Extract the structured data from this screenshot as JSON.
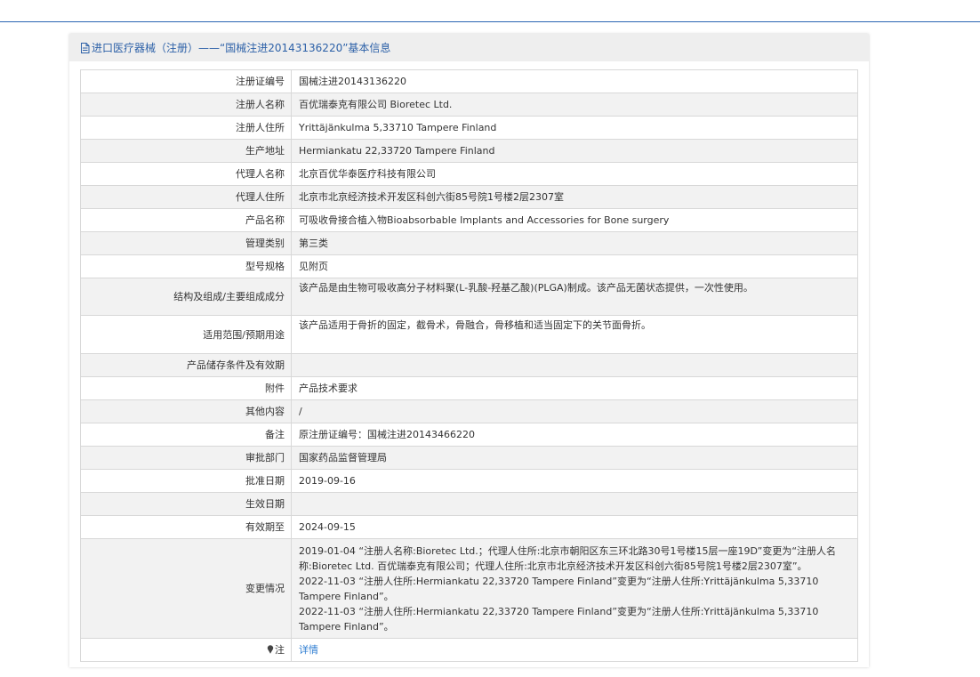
{
  "header": {
    "title_prefix": "进口医疗器械（注册）——",
    "title_quote": "“国械注进20143136220”基本信息"
  },
  "rows": [
    {
      "label": "注册证编号",
      "value": "国械注进20143136220"
    },
    {
      "label": "注册人名称",
      "value": "百优瑞泰克有限公司 Bioretec Ltd."
    },
    {
      "label": "注册人住所",
      "value": "Yrittäjänkulma 5,33710 Tampere Finland"
    },
    {
      "label": "生产地址",
      "value": "Hermiankatu 22,33720 Tampere Finland"
    },
    {
      "label": "代理人名称",
      "value": "北京百优华泰医疗科技有限公司"
    },
    {
      "label": "代理人住所",
      "value": "北京市北京经济技术开发区科创六街85号院1号楼2层2307室"
    },
    {
      "label": "产品名称",
      "value": "可吸收骨接合植入物Bioabsorbable Implants and Accessories for Bone surgery"
    },
    {
      "label": "管理类别",
      "value": "第三类"
    },
    {
      "label": "型号规格",
      "value": "见附页"
    },
    {
      "label": "结构及组成/主要组成成分",
      "value": "该产品是由生物可吸收高分子材料聚(L-乳酸-羟基乙酸)(PLGA)制成。该产品无菌状态提供，一次性使用。"
    },
    {
      "label": "适用范围/预期用途",
      "value": "该产品适用于骨折的固定，截骨术，骨融合，骨移植和适当固定下的关节面骨折。"
    },
    {
      "label": "产品储存条件及有效期",
      "value": ""
    },
    {
      "label": "附件",
      "value": "产品技术要求"
    },
    {
      "label": "其他内容",
      "value": "/"
    },
    {
      "label": "备注",
      "value": "原注册证编号：国械注进20143466220"
    },
    {
      "label": "审批部门",
      "value": "国家药品监督管理局"
    },
    {
      "label": "批准日期",
      "value": "2019-09-16"
    },
    {
      "label": "生效日期",
      "value": ""
    },
    {
      "label": "有效期至",
      "value": "2024-09-15"
    }
  ],
  "changes": {
    "label": "变更情况",
    "items": [
      "2019-01-04 “注册人名称:Bioretec Ltd.；代理人住所:北京市朝阳区东三环北路30号1号楼15层一座19D”变更为“注册人名称:Bioretec Ltd. 百优瑞泰克有限公司；代理人住所:北京市北京经济技术开发区科创六街85号院1号楼2层2307室”。",
      "2022-11-03 “注册人住所:Hermiankatu 22,33720 Tampere Finland”变更为“注册人住所:Yrittäjänkulma 5,33710 Tampere Finland”。",
      "2022-11-03 “注册人住所:Hermiankatu 22,33720 Tampere Finland”变更为“注册人住所:Yrittäjänkulma 5,33710 Tampere Finland”。"
    ]
  },
  "note": {
    "label": "注",
    "link": "详情"
  },
  "colors": {
    "accent": "#2d61a8",
    "link": "#2d7cd1",
    "header_bg": "#eeeeee",
    "row_alt_bg": "#f2f2f2",
    "border": "#d8d8d8"
  }
}
